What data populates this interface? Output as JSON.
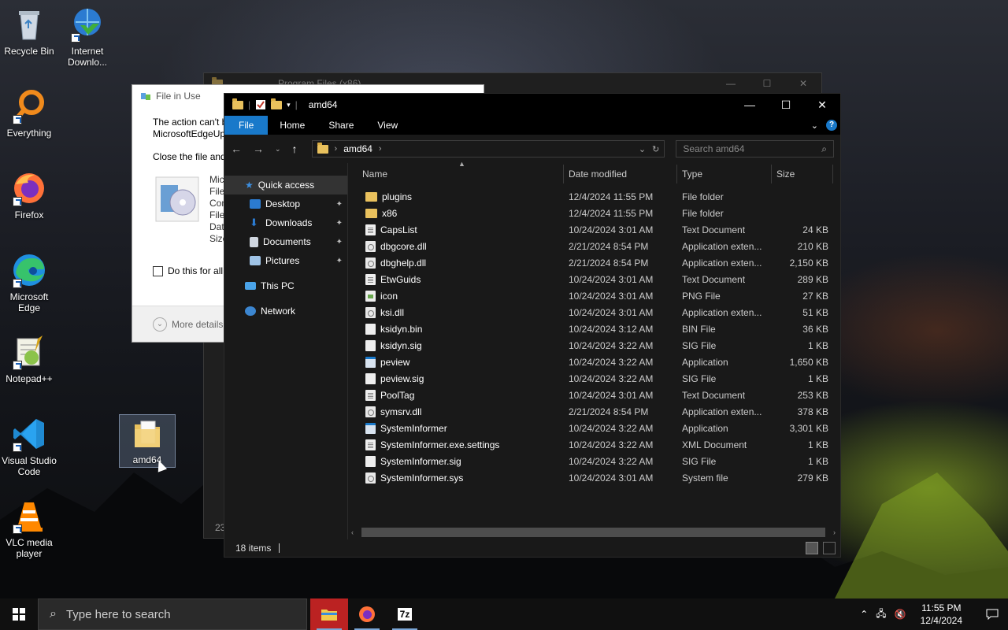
{
  "desktop": {
    "icons": [
      {
        "label": "Recycle Bin"
      },
      {
        "label": "Internet Downlo..."
      },
      {
        "label": "Everything"
      },
      {
        "label": "Firefox"
      },
      {
        "label": "Microsoft Edge"
      },
      {
        "label": "Notepad++"
      },
      {
        "label": "Visual Studio Code"
      },
      {
        "label": "VLC media player"
      },
      {
        "label": "amd64"
      }
    ]
  },
  "back_window": {
    "title": "Program Files (x86)",
    "status": "23"
  },
  "dialog": {
    "title": "File in Use",
    "message_1": "The action can't b",
    "message_2": "MicrosoftEdgeUp",
    "instruction": "Close the file and",
    "meta": [
      "Mic",
      "File",
      "Con",
      "File",
      "Date",
      "Size"
    ],
    "checkbox_label": "Do this for all",
    "more_details": "More details"
  },
  "explorer": {
    "title": "amd64",
    "ribbon_tabs": [
      "File",
      "Home",
      "Share",
      "View"
    ],
    "address_path": "amd64",
    "search_placeholder": "Search amd64",
    "nav": {
      "quick_access": "Quick access",
      "desktop": "Desktop",
      "downloads": "Downloads",
      "documents": "Documents",
      "pictures": "Pictures",
      "this_pc": "This PC",
      "network": "Network"
    },
    "columns": [
      "Name",
      "Date modified",
      "Type",
      "Size"
    ],
    "files": [
      {
        "name": "plugins",
        "date": "12/4/2024 11:55 PM",
        "type": "File folder",
        "size": "",
        "icon": "folder"
      },
      {
        "name": "x86",
        "date": "12/4/2024 11:55 PM",
        "type": "File folder",
        "size": "",
        "icon": "folder"
      },
      {
        "name": "CapsList",
        "date": "10/24/2024 3:01 AM",
        "type": "Text Document",
        "size": "24 KB",
        "icon": "text"
      },
      {
        "name": "dbgcore.dll",
        "date": "2/21/2024 8:54 PM",
        "type": "Application exten...",
        "size": "210 KB",
        "icon": "gear"
      },
      {
        "name": "dbghelp.dll",
        "date": "2/21/2024 8:54 PM",
        "type": "Application exten...",
        "size": "2,150 KB",
        "icon": "gear"
      },
      {
        "name": "EtwGuids",
        "date": "10/24/2024 3:01 AM",
        "type": "Text Document",
        "size": "289 KB",
        "icon": "text"
      },
      {
        "name": "icon",
        "date": "10/24/2024 3:01 AM",
        "type": "PNG File",
        "size": "27 KB",
        "icon": "img"
      },
      {
        "name": "ksi.dll",
        "date": "10/24/2024 3:01 AM",
        "type": "Application exten...",
        "size": "51 KB",
        "icon": "gear"
      },
      {
        "name": "ksidyn.bin",
        "date": "10/24/2024 3:12 AM",
        "type": "BIN File",
        "size": "36 KB",
        "icon": "blank"
      },
      {
        "name": "ksidyn.sig",
        "date": "10/24/2024 3:22 AM",
        "type": "SIG File",
        "size": "1 KB",
        "icon": "blank"
      },
      {
        "name": "peview",
        "date": "10/24/2024 3:22 AM",
        "type": "Application",
        "size": "1,650 KB",
        "icon": "app"
      },
      {
        "name": "peview.sig",
        "date": "10/24/2024 3:22 AM",
        "type": "SIG File",
        "size": "1 KB",
        "icon": "blank"
      },
      {
        "name": "PoolTag",
        "date": "10/24/2024 3:01 AM",
        "type": "Text Document",
        "size": "253 KB",
        "icon": "text"
      },
      {
        "name": "symsrv.dll",
        "date": "2/21/2024 8:54 PM",
        "type": "Application exten...",
        "size": "378 KB",
        "icon": "gear"
      },
      {
        "name": "SystemInformer",
        "date": "10/24/2024 3:22 AM",
        "type": "Application",
        "size": "3,301 KB",
        "icon": "app"
      },
      {
        "name": "SystemInformer.exe.settings",
        "date": "10/24/2024 3:22 AM",
        "type": "XML Document",
        "size": "1 KB",
        "icon": "text"
      },
      {
        "name": "SystemInformer.sig",
        "date": "10/24/2024 3:22 AM",
        "type": "SIG File",
        "size": "1 KB",
        "icon": "blank"
      },
      {
        "name": "SystemInformer.sys",
        "date": "10/24/2024 3:01 AM",
        "type": "System file",
        "size": "279 KB",
        "icon": "gear"
      }
    ],
    "status_items": "18 items"
  },
  "taskbar": {
    "search_placeholder": "Type here to search",
    "time": "11:55 PM",
    "date": "12/4/2024",
    "apps": [
      "file-explorer",
      "firefox",
      "7-zip"
    ],
    "seven_zip_label": "7z"
  },
  "colors": {
    "accent": "#1979ca",
    "folder": "#e9c15d",
    "explorer_bg": "#191919",
    "taskbar_bg": "#101010"
  }
}
